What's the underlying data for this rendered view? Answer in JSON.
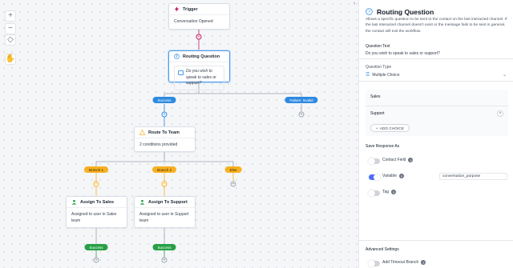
{
  "zoom_controls": {
    "zoom_in": "+",
    "zoom_out": "−",
    "fit": "◇",
    "lock": "✋"
  },
  "nodes": {
    "trigger": {
      "title": "Trigger",
      "body": "Conversation Opened"
    },
    "routing_question": {
      "title": "Routing Question",
      "question": "Do you wish to speak to sales or support?"
    },
    "route_to_team": {
      "title": "Route To Team",
      "body": "2 conditions provided"
    },
    "assign_sales": {
      "title": "Assign To Sales",
      "body_prefix": "Assigned to user in ",
      "body_italic": "Sales",
      "body_suffix": " team"
    },
    "assign_support": {
      "title": "Assign To Support",
      "body_prefix": "Assigned to user in ",
      "body_italic": "Support",
      "body_suffix": " team"
    }
  },
  "pills": {
    "success": "Success",
    "failure": "Failure: Invalid",
    "branch1": "Branch 1",
    "branch2": "Branch 2",
    "else": "Else",
    "success_sales": "Success",
    "success_support": "Success"
  },
  "panel": {
    "title": "Routing Question",
    "description": "Allows a specific question to be sent to the contact on the last interacted channel. If the last interacted channel doesn't exist or the message fails to be sent in general, the contact will exit the workflow.",
    "question_text_label": "Question Text",
    "question_text_value": "Do you wish to speak to sales or support?",
    "question_type_label": "Question Type",
    "question_type_value": "Multiple Choice",
    "choices": [
      "Sales",
      "Support"
    ],
    "add_choice_label": "ADD CHOICE",
    "save_response_label": "Save Response As",
    "options": [
      {
        "label": "Contact Field",
        "on": false
      },
      {
        "label": "Variable",
        "on": true,
        "value": "conversation_purpose"
      },
      {
        "label": "Tag",
        "on": false
      }
    ],
    "advanced_label": "Advanced Settings",
    "timeout_label": "Add Timeout Branch"
  },
  "colors": {
    "accent": "#4f6ef7",
    "success": "#27a046",
    "branch": "#f7b021",
    "trigger": "#c2185b",
    "link": "#2d8ae0"
  }
}
